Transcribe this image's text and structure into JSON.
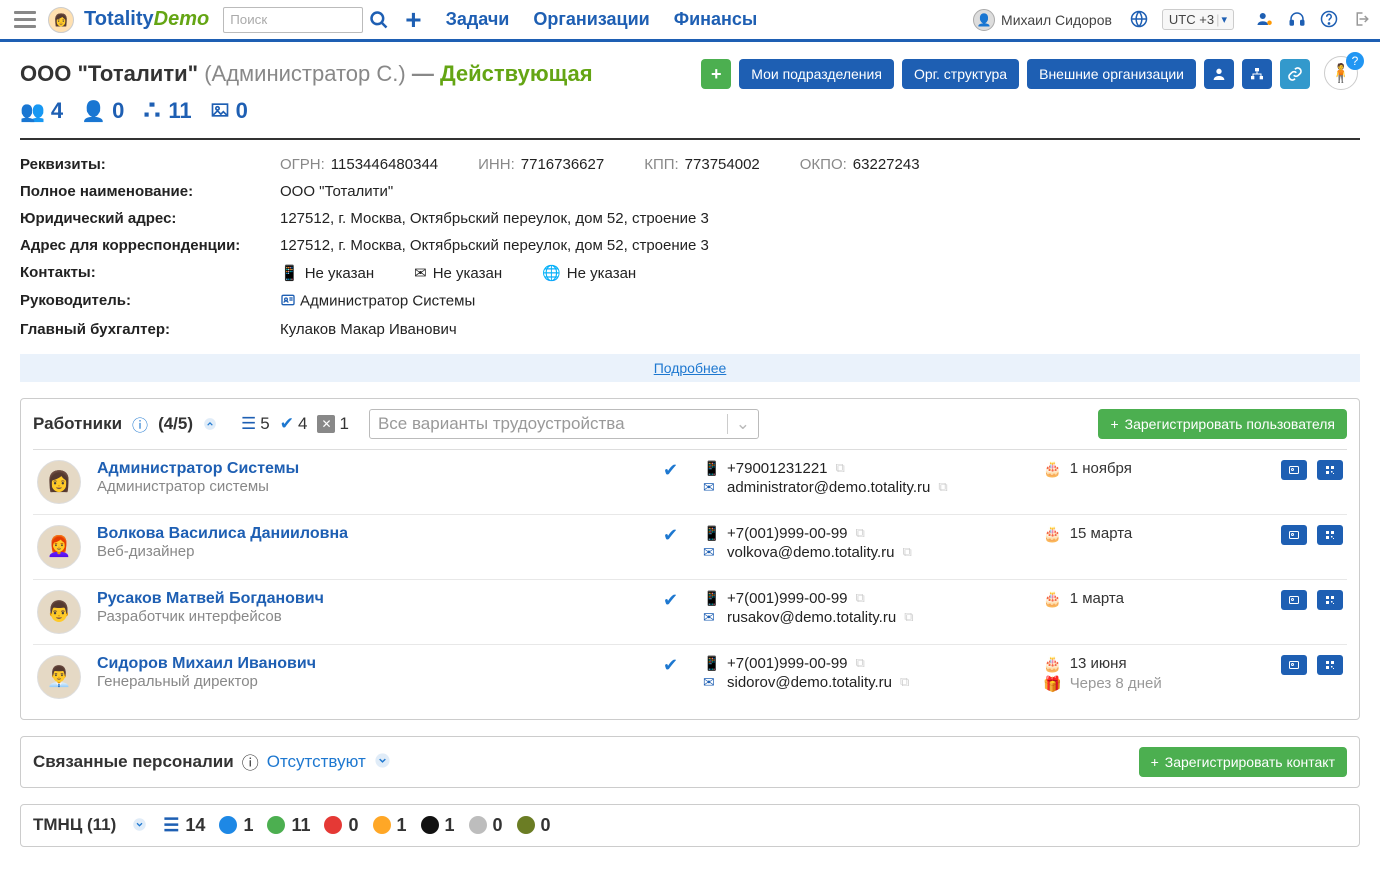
{
  "header": {
    "brand1": "Totality",
    "brand2": "Demo",
    "search_placeholder": "Поиск",
    "nav": [
      "Задачи",
      "Организации",
      "Финансы"
    ],
    "user_name": "Михаил Сидоров",
    "tz": "UTC +3"
  },
  "org": {
    "name": "ООО \"Тоталити\"",
    "admin": "(Администратор С.)",
    "dash": "—",
    "status": "Действующая",
    "buttons": {
      "my_divisions": "Мои подразделения",
      "org_structure": "Орг. структура",
      "external_orgs": "Внешние организации"
    },
    "stats": {
      "groups": "4",
      "depts": "0",
      "orgchart": "11",
      "imgs": "0"
    }
  },
  "details": {
    "requisites_label": "Реквизиты:",
    "req": {
      "ogrn_k": "ОГРН:",
      "ogrn_v": "1153446480344",
      "inn_k": "ИНН:",
      "inn_v": "7716736627",
      "kpp_k": "КПП:",
      "kpp_v": "773754002",
      "okpo_k": "ОКПО:",
      "okpo_v": "63227243"
    },
    "full_name_label": "Полное наименование:",
    "full_name": "ООО \"Тоталити\"",
    "legal_addr_label": "Юридический адрес:",
    "legal_addr": "127512, г. Москва, Октябрьский переулок, дом 52, строение 3",
    "corr_addr_label": "Адрес для корреспонденции:",
    "corr_addr": "127512, г. Москва, Октябрьский переулок, дом 52, строение 3",
    "contacts_label": "Контакты:",
    "contacts_none": "Не указан",
    "director_label": "Руководитель:",
    "director": "Администратор Системы",
    "accountant_label": "Главный бухгалтер:",
    "accountant": "Кулаков Макар Иванович",
    "more": "Подробнее"
  },
  "employees": {
    "title": "Работники",
    "count": "(4/5)",
    "chips": {
      "all": "5",
      "active": "4",
      "inactive": "1"
    },
    "placeholder": "Все варианты трудоустройства",
    "register_btn": "Зарегистрировать пользователя",
    "rows": [
      {
        "name": "Администратор Системы",
        "role": "Администратор системы",
        "phone": "+79001231221",
        "email": "administrator@demo.totality.ru",
        "bday": "1 ноября",
        "anniv": ""
      },
      {
        "name": "Волкова Василиса Данииловна",
        "role": "Веб-дизайнер",
        "phone": "+7(001)999-00-99",
        "email": "volkova@demo.totality.ru",
        "bday": "15 марта",
        "anniv": ""
      },
      {
        "name": "Русаков Матвей Богданович",
        "role": "Разработчик интерфейсов",
        "phone": "+7(001)999-00-99",
        "email": "rusakov@demo.totality.ru",
        "bday": "1 марта",
        "anniv": ""
      },
      {
        "name": "Сидоров Михаил Иванович",
        "role": "Генеральный директор",
        "phone": "+7(001)999-00-99",
        "email": "sidorov@demo.totality.ru",
        "bday": "13 июня",
        "anniv": "Через 8 дней"
      }
    ]
  },
  "personas": {
    "title": "Связанные персоналии",
    "none": "Отсутствуют",
    "register_btn": "Зарегистрировать контакт"
  },
  "tmnc": {
    "title": "ТМНЦ (11)",
    "tags": [
      {
        "color": "bars",
        "val": "14"
      },
      {
        "color": "#1e88e5",
        "val": "1"
      },
      {
        "color": "#4caf50",
        "val": "11"
      },
      {
        "color": "#e53935",
        "val": "0"
      },
      {
        "color": "#ffa726",
        "val": "1"
      },
      {
        "color": "#111111",
        "val": "1"
      },
      {
        "color": "#bdbdbd",
        "val": "0"
      },
      {
        "color": "#6b7d24",
        "val": "0"
      }
    ]
  }
}
